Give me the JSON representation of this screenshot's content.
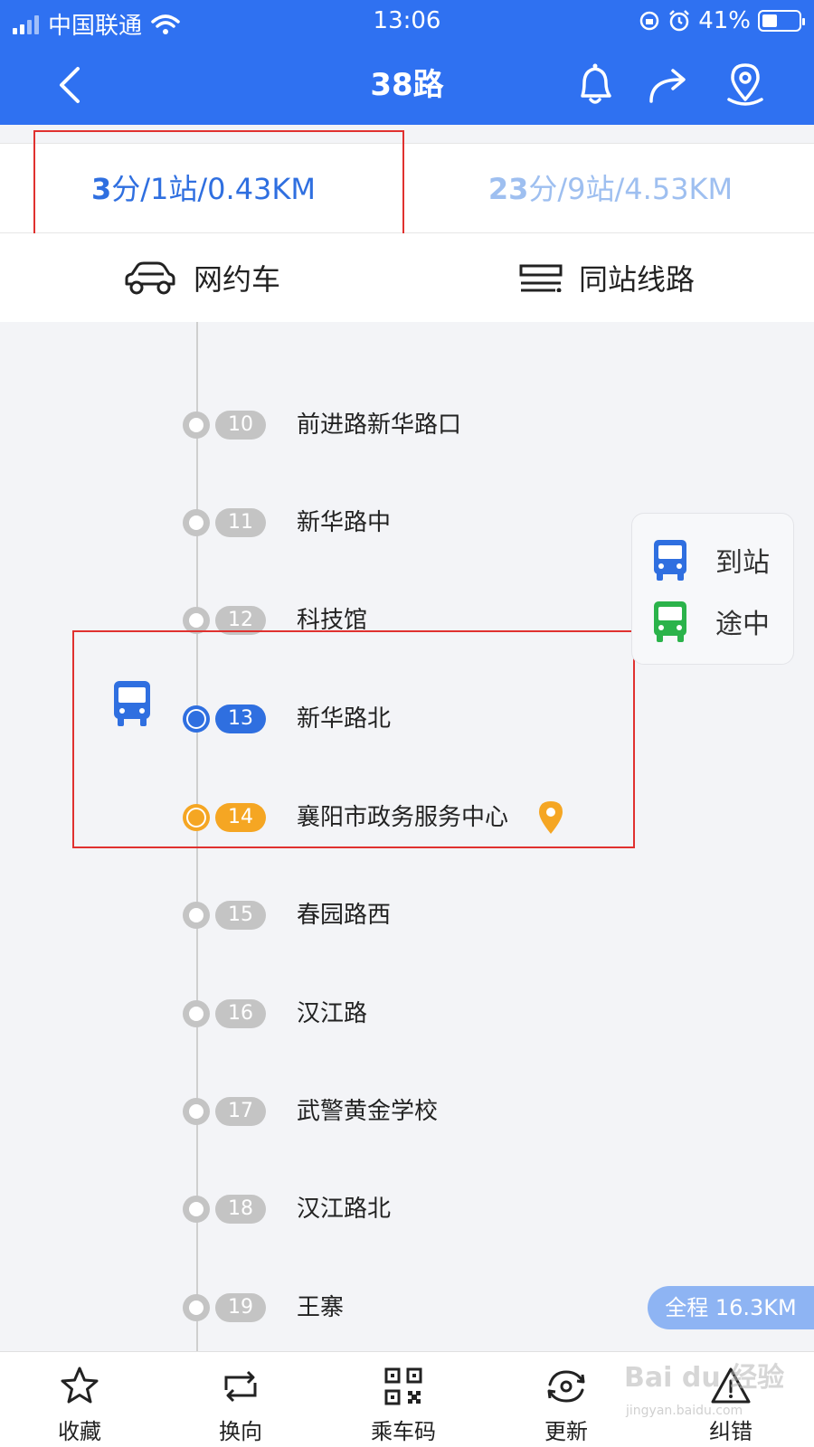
{
  "status_bar": {
    "carrier": "中国联通",
    "time": "13:06",
    "battery": "41%"
  },
  "nav": {
    "title": "38路"
  },
  "tabs": [
    {
      "label_prefix": "3",
      "label_rest": "分/1站/0.43KM"
    },
    {
      "label_prefix": "23",
      "label_rest": "分/9站/4.53KM"
    }
  ],
  "quick_actions": {
    "ride_hailing": "网约车",
    "same_stop_routes": "同站线路"
  },
  "stops": [
    {
      "num": "10",
      "name": "前进路新华路口",
      "state": "normal"
    },
    {
      "num": "11",
      "name": "新华路中",
      "state": "normal"
    },
    {
      "num": "12",
      "name": "科技馆",
      "state": "normal"
    },
    {
      "num": "13",
      "name": "新华路北",
      "state": "bus"
    },
    {
      "num": "14",
      "name": "襄阳市政务服务中心",
      "state": "current"
    },
    {
      "num": "15",
      "name": "春园路西",
      "state": "normal"
    },
    {
      "num": "16",
      "name": "汉江路",
      "state": "normal"
    },
    {
      "num": "17",
      "name": "武警黄金学校",
      "state": "normal"
    },
    {
      "num": "18",
      "name": "汉江路北",
      "state": "normal"
    },
    {
      "num": "19",
      "name": "王寨",
      "state": "normal"
    }
  ],
  "legend": {
    "arrived": "到站",
    "en_route": "途中"
  },
  "total_distance": "全程 16.3KM",
  "toolbar": {
    "favorite": "收藏",
    "reverse": "换向",
    "ride_code": "乘车码",
    "refresh": "更新",
    "report_error": "纠错"
  },
  "watermark": {
    "text": "Bai du 经验",
    "url": "jingyan.baidu.com"
  },
  "colors": {
    "primary": "#2f71f1",
    "orange": "#f5a623",
    "green": "#2bb34a",
    "highlight": "#e0312f"
  }
}
